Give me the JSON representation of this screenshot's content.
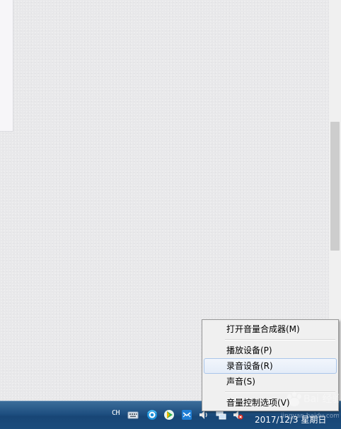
{
  "menu": {
    "items": [
      {
        "label": "打开音量合成器(M)"
      },
      {
        "label": "播放设备(P)"
      },
      {
        "label": "录音设备(R)",
        "highlighted": true
      },
      {
        "label": "声音(S)"
      },
      {
        "label": "音量控制选项(V)"
      }
    ]
  },
  "taskbar": {
    "language": "CH",
    "tray_icons": [
      "keyboard-icon",
      "browser-icon",
      "media-player-icon",
      "mail-icon",
      "volume-icon",
      "network-icon",
      "volume-muted-icon"
    ],
    "clock": "2017/12/3 星期日"
  },
  "watermark": {
    "text": "Bai 经验",
    "url": "jingyan.baidu.com"
  },
  "colors": {
    "taskbar": "#1e4f80",
    "menu_background": "#f0f0f0",
    "menu_highlight_border": "#aac6ea",
    "desktop": "#e8e8ea"
  }
}
